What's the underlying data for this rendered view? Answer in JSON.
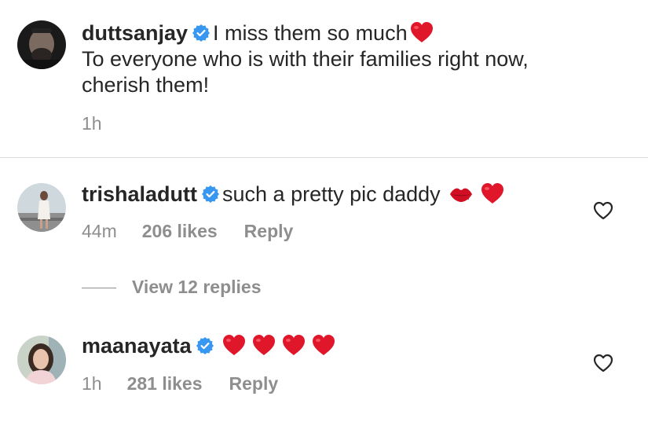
{
  "post": {
    "username": "duttsanjay",
    "verified_icon": "verified-badge-icon",
    "line1": "I miss them so much",
    "line2": "To everyone who is with their families right now,",
    "line3": "cherish them!",
    "time": "1h"
  },
  "comments": [
    {
      "username": "trishaladutt",
      "text": "such a pretty pic daddy",
      "emojis": [
        "lips-emoji",
        "red-heart-emoji"
      ],
      "time": "44m",
      "likes": "206 likes",
      "reply": "Reply"
    },
    {
      "username": "maanayata",
      "text": "",
      "emojis": [
        "red-heart-emoji",
        "red-heart-emoji",
        "red-heart-emoji",
        "red-heart-emoji"
      ],
      "time": "1h",
      "likes": "281 likes",
      "reply": "Reply"
    }
  ],
  "view_replies": "View 12 replies",
  "colors": {
    "text": "#262626",
    "muted": "#8e8e8e",
    "verified": "#3897f0",
    "heart": "#e0162b",
    "divider": "#dbdbdb"
  }
}
